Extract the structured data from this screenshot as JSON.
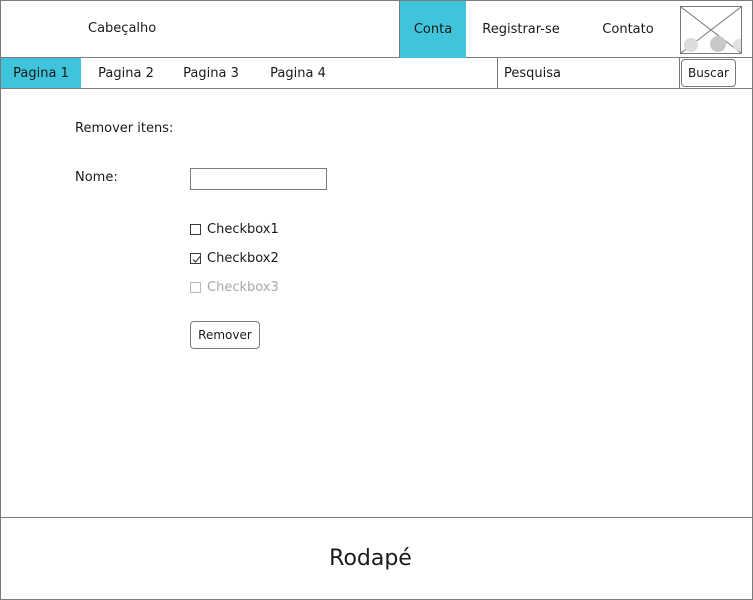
{
  "header": {
    "title": "Cabeçalho",
    "nav": [
      {
        "label": "Conta",
        "active": true
      },
      {
        "label": "Registrar-se",
        "active": false
      },
      {
        "label": "Contato",
        "active": false
      }
    ],
    "logo_icon": "image-placeholder-icon"
  },
  "tabs": [
    {
      "label": "Pagina 1",
      "active": true
    },
    {
      "label": "Pagina 2",
      "active": false
    },
    {
      "label": "Pagina 3",
      "active": false
    },
    {
      "label": "Pagina 4",
      "active": false
    }
  ],
  "search": {
    "placeholder": "Pesquisa",
    "value": "",
    "button_label": "Buscar"
  },
  "form": {
    "title": "Remover itens:",
    "name_label": "Nome:",
    "name_value": "",
    "checkboxes": [
      {
        "label": "Checkbox1",
        "checked": false,
        "disabled": false
      },
      {
        "label": "Checkbox2",
        "checked": true,
        "disabled": false
      },
      {
        "label": "Checkbox3",
        "checked": false,
        "disabled": true
      }
    ],
    "submit_label": "Remover"
  },
  "footer": {
    "text": "Rodapé"
  },
  "colors": {
    "accent": "#40c4dc",
    "border": "#7a7a7a",
    "disabled_text": "#a8a8a8"
  }
}
